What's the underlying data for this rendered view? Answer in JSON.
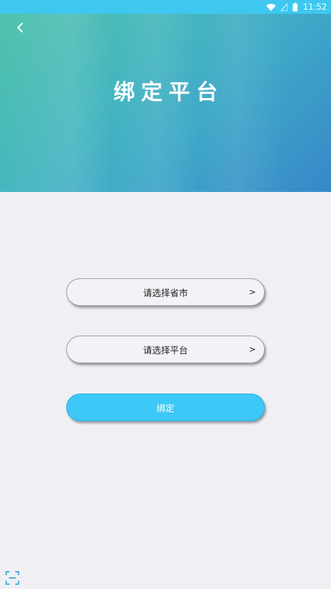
{
  "status_bar": {
    "time": "11:52",
    "icons": [
      "wifi-icon",
      "signal-icon",
      "battery-icon"
    ]
  },
  "header": {
    "title": "绑定平台",
    "back_icon": "chevron-left-icon"
  },
  "form": {
    "province_city_select": {
      "placeholder": "请选择省市",
      "arrow": ">"
    },
    "platform_select": {
      "placeholder": "请选择平台",
      "arrow": ">"
    },
    "bind_button": {
      "label": "绑定"
    }
  },
  "footer": {
    "scan_icon": "scan-icon"
  },
  "colors": {
    "status_bar": "#3ec8f0",
    "header_gradient_start": "#4fc2ab",
    "header_gradient_end": "#3788c9",
    "background": "#f0eff4",
    "bind_button": "#3ec8f7"
  }
}
